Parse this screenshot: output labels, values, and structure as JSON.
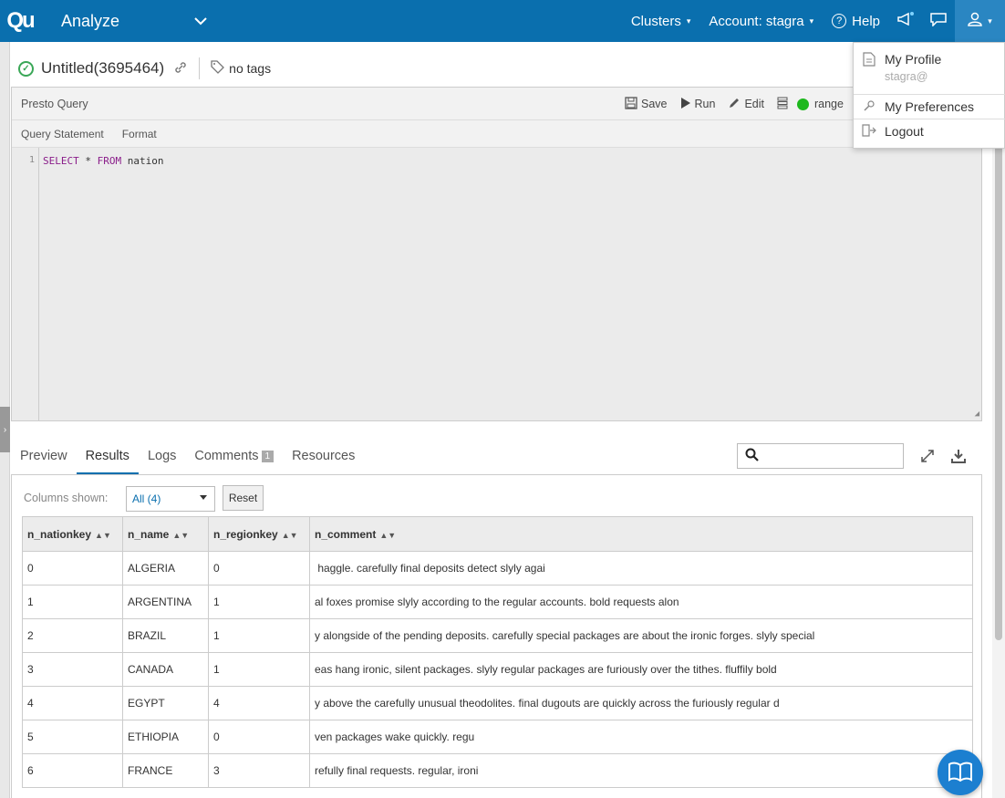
{
  "app": {
    "logo": "Qu",
    "title": "Analyze"
  },
  "nav": {
    "clusters": "Clusters",
    "account": "Account: stagra",
    "help": "Help"
  },
  "query": {
    "title": "Untitled(3695464)",
    "tags": "no tags",
    "panel_title": "Presto Query",
    "save": "Save",
    "run": "Run",
    "edit": "Edit",
    "cluster": "range",
    "subtabs": [
      "Query Statement",
      "Format"
    ],
    "line_number": "1",
    "code_kw1": "SELECT",
    "code_mid": " * ",
    "code_kw2": "FROM",
    "code_tail": " nation"
  },
  "result_tabs": {
    "preview": "Preview",
    "results": "Results",
    "logs": "Logs",
    "comments": "Comments",
    "comments_count": "1",
    "resources": "Resources"
  },
  "results": {
    "columns_label": "Columns shown:",
    "columns_value": "All (4)",
    "reset": "Reset",
    "headers": [
      "n_nationkey",
      "n_name",
      "n_regionkey",
      "n_comment"
    ],
    "rows": [
      [
        "0",
        "ALGERIA",
        "0",
        " haggle. carefully final deposits detect slyly agai"
      ],
      [
        "1",
        "ARGENTINA",
        "1",
        "al foxes promise slyly according to the regular accounts. bold requests alon"
      ],
      [
        "2",
        "BRAZIL",
        "1",
        "y alongside of the pending deposits. carefully special packages are about the ironic forges. slyly special"
      ],
      [
        "3",
        "CANADA",
        "1",
        "eas hang ironic, silent packages. slyly regular packages are furiously over the tithes. fluffily bold"
      ],
      [
        "4",
        "EGYPT",
        "4",
        "y above the carefully unusual theodolites. final dugouts are quickly across the furiously regular d"
      ],
      [
        "5",
        "ETHIOPIA",
        "0",
        "ven packages wake quickly. regu"
      ],
      [
        "6",
        "FRANCE",
        "3",
        "refully final requests. regular, ironi"
      ]
    ]
  },
  "user_menu": {
    "profile": "My Profile",
    "email": "stagra@",
    "preferences": "My Preferences",
    "logout": "Logout"
  },
  "colors": {
    "primary": "#0a6fae",
    "status_ok": "#3aa757",
    "cluster_up": "#1db81d"
  }
}
